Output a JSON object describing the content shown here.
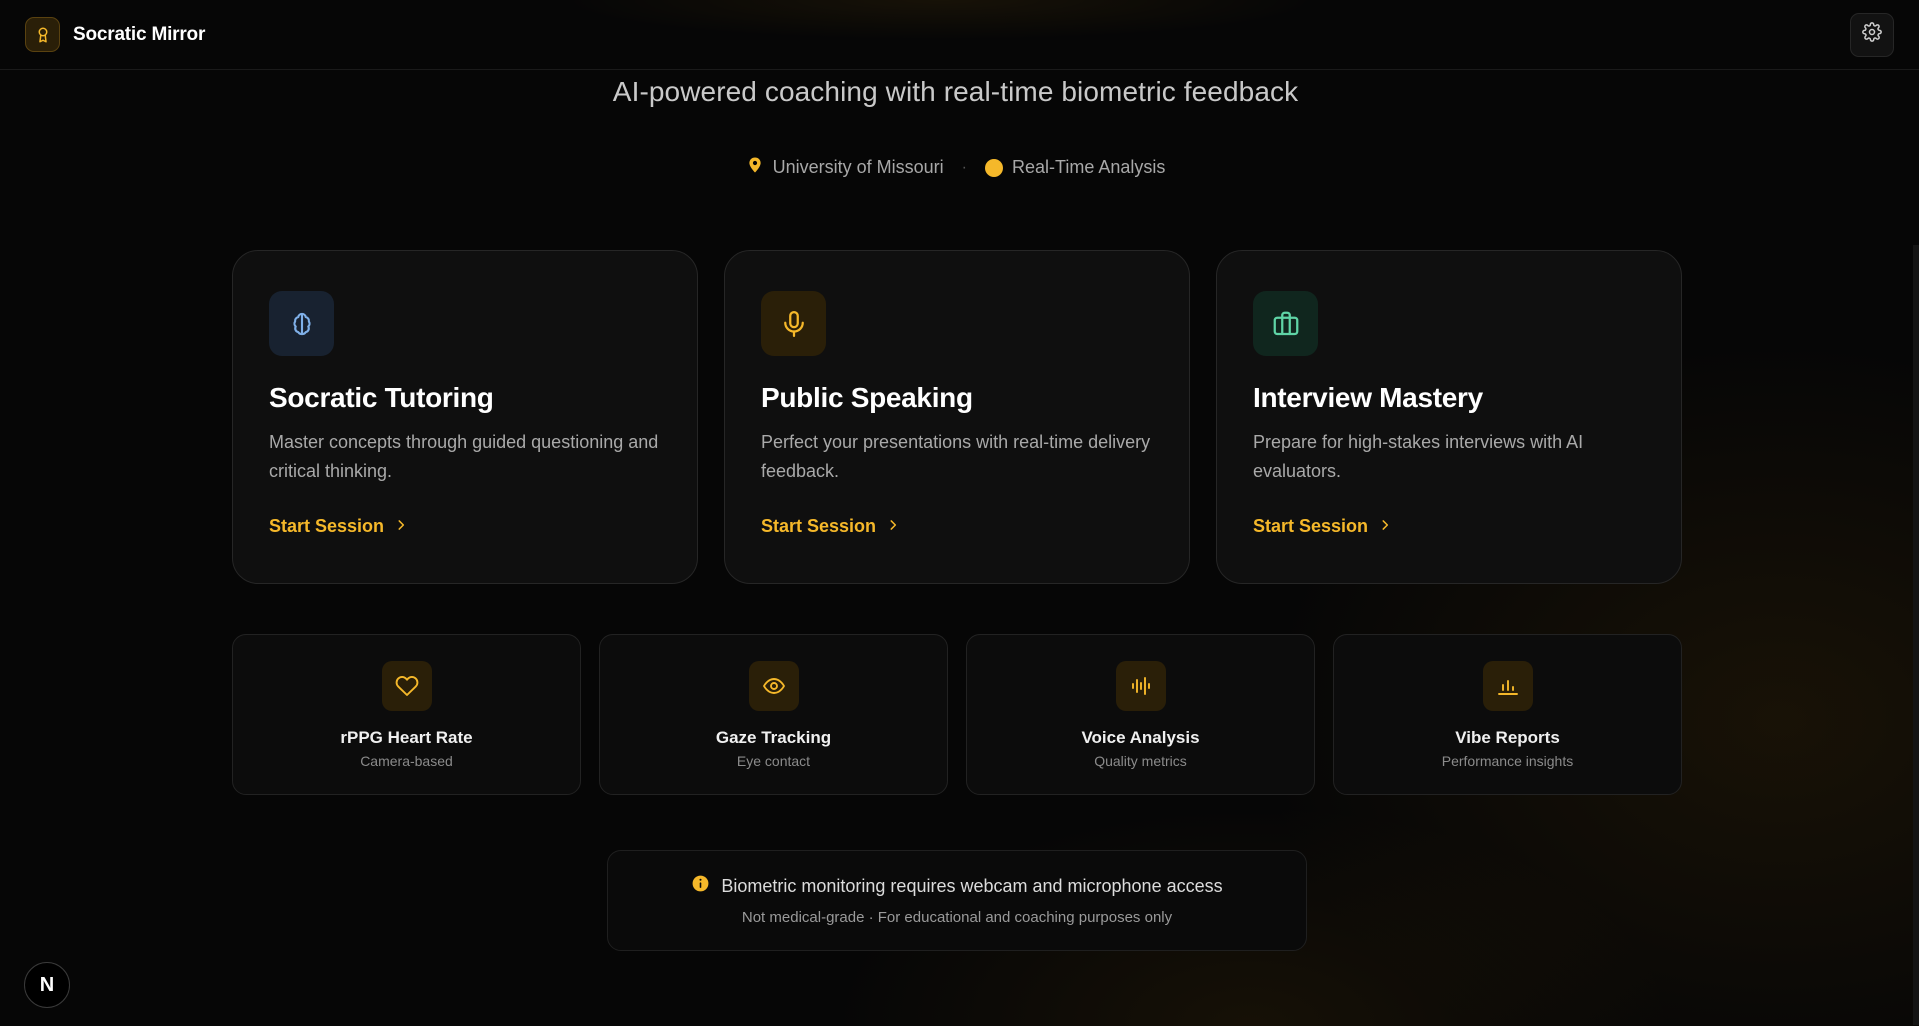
{
  "header": {
    "app_name": "Socratic Mirror",
    "logo_icon": "award-icon",
    "settings_icon": "gear-icon"
  },
  "hero": {
    "tagline": "AI-powered coaching with real-time biometric feedback",
    "location": "University of Missouri",
    "separator": "·",
    "status": "Real-Time Analysis"
  },
  "modes": [
    {
      "title": "Socratic Tutoring",
      "description": "Master concepts through guided questioning and critical thinking.",
      "cta": "Start Session",
      "icon": "brain-icon"
    },
    {
      "title": "Public Speaking",
      "description": "Perfect your presentations with real-time delivery feedback.",
      "cta": "Start Session",
      "icon": "microphone-icon"
    },
    {
      "title": "Interview Mastery",
      "description": "Prepare for high-stakes interviews with AI evaluators.",
      "cta": "Start Session",
      "icon": "briefcase-icon"
    }
  ],
  "features": [
    {
      "title": "rPPG Heart Rate",
      "subtitle": "Camera-based",
      "icon": "heart-icon"
    },
    {
      "title": "Gaze Tracking",
      "subtitle": "Eye contact",
      "icon": "eye-icon"
    },
    {
      "title": "Voice Analysis",
      "subtitle": "Quality metrics",
      "icon": "audio-waveform-icon"
    },
    {
      "title": "Vibe Reports",
      "subtitle": "Performance insights",
      "icon": "bar-chart-icon"
    }
  ],
  "notice": {
    "main": "Biometric monitoring requires webcam and microphone access",
    "sub": "Not medical-grade · For educational and coaching purposes only"
  },
  "badge": {
    "letter": "N"
  },
  "colors": {
    "accent": "#f5b82a",
    "brain_blue": "#7fb0e8",
    "briefcase_green": "#5fd4a6",
    "background": "#060606",
    "card": "#0f0f0f"
  }
}
